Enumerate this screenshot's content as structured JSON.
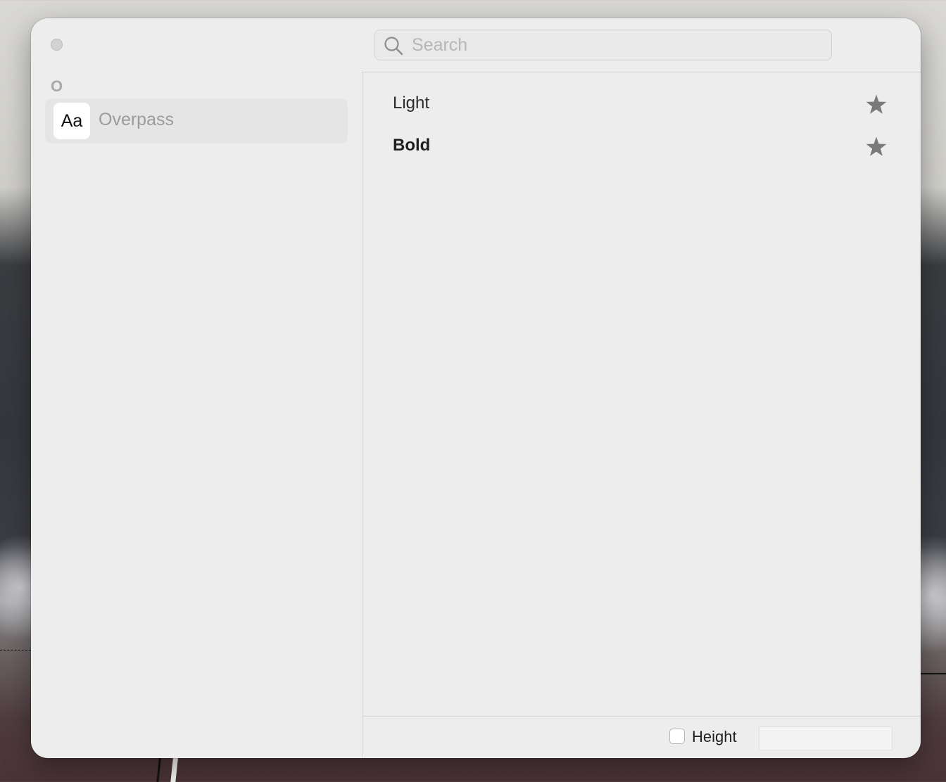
{
  "window": {
    "close_button": "close"
  },
  "sidebar": {
    "section_letter": "O",
    "families": [
      {
        "preview": "Aa",
        "name": "Overpass"
      }
    ]
  },
  "search": {
    "placeholder": "Search",
    "value": ""
  },
  "styles": [
    {
      "name": "Light",
      "weight": "light",
      "favorite_icon": "star-icon"
    },
    {
      "name": "Bold",
      "weight": "bold",
      "favorite_icon": "star-icon"
    }
  ],
  "footer": {
    "height_checkbox_checked": false,
    "height_label": "Height",
    "height_value": ""
  },
  "colors": {
    "window_bg": "#ededed",
    "selected_row_bg": "#e5e5e5",
    "star": "#7a7a7a"
  }
}
